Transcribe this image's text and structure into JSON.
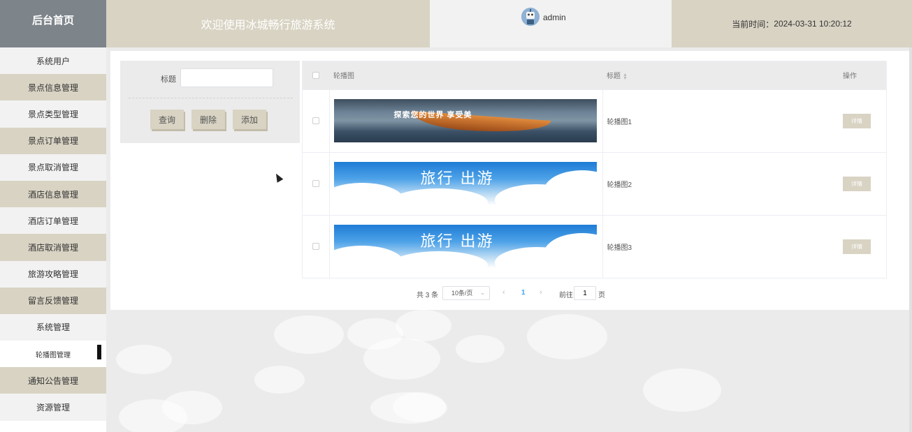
{
  "header": {
    "home_label": "后台首页",
    "title": "欢迎使用冰城畅行旅游系统",
    "username": "admin",
    "time_label": "当前时间：",
    "time_value": "2024-03-31 10:20:12"
  },
  "sidebar": {
    "items": [
      {
        "label": "系统用户"
      },
      {
        "label": "景点信息管理"
      },
      {
        "label": "景点类型管理"
      },
      {
        "label": "景点订单管理"
      },
      {
        "label": "景点取消管理"
      },
      {
        "label": "酒店信息管理"
      },
      {
        "label": "酒店订单管理"
      },
      {
        "label": "酒店取消管理"
      },
      {
        "label": "旅游攻略管理"
      },
      {
        "label": "留言反馈管理"
      },
      {
        "label": "系统管理"
      },
      {
        "label": "轮播图管理"
      },
      {
        "label": "通知公告管理"
      },
      {
        "label": "资源管理"
      }
    ],
    "active_index": 11
  },
  "search": {
    "title_label": "标题",
    "title_value": "",
    "query_label": "查询",
    "delete_label": "删除",
    "add_label": "添加"
  },
  "table": {
    "columns": {
      "image": "轮播图",
      "title": "标题",
      "action": "操作"
    },
    "rows": [
      {
        "title": "轮播图1",
        "image_text": "探索您的世界 享受美",
        "action": "详情"
      },
      {
        "title": "轮播图2",
        "image_text": "旅行 出游",
        "action": "详情"
      },
      {
        "title": "轮播图3",
        "image_text": "旅行 出游",
        "action": "详情"
      }
    ]
  },
  "pagination": {
    "total": "共 3 条",
    "page_size": "10条/页",
    "current_page": "1",
    "goto_label": "前往",
    "goto_value": "1",
    "page_suffix": "页"
  },
  "colors": {
    "accent": "#d8d3c3",
    "header_home": "#7d848a",
    "sidebar_alt": "#f2f2f2",
    "page_bg": "#ebebeb"
  }
}
